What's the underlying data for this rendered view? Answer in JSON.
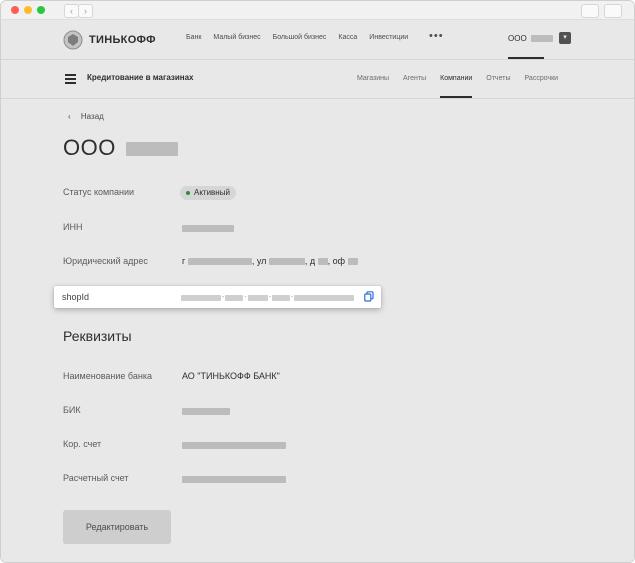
{
  "browser": {
    "back_icon": "chevron-left-icon",
    "forward_icon": "chevron-right-icon"
  },
  "header": {
    "logo_text": "ТИНЬКОФФ",
    "nav": [
      "Банк",
      "Малый бизнес",
      "Большой бизнес",
      "Касса",
      "Инвестиции"
    ],
    "more_label": "•••",
    "company_label": "ООО"
  },
  "subheader": {
    "title": "Кредитование в магазинах",
    "tabs": [
      "Магазины",
      "Агенты",
      "Компании",
      "Отчеты",
      "Рассрочки"
    ],
    "active_tab": "Компании"
  },
  "company": {
    "back_label": "Назад",
    "title_prefix": "ООО",
    "status_label": "Статус компании",
    "status_value": "Активный",
    "status_color": "#2e9d4a",
    "inn_label": "ИНН",
    "address_label": "Юридический адрес",
    "address_parts": [
      "г",
      ", ул",
      ", д",
      ", оф"
    ],
    "shopid_label": "shopId"
  },
  "requisites": {
    "title": "Реквизиты",
    "bank_name_label": "Наименование банка",
    "bank_name_value": "АО \"ТИНЬКОФФ БАНК\"",
    "bik_label": "БИК",
    "kor_label": "Кор. счет",
    "account_label": "Расчетный счет"
  },
  "actions": {
    "edit_label": "Редактировать"
  }
}
